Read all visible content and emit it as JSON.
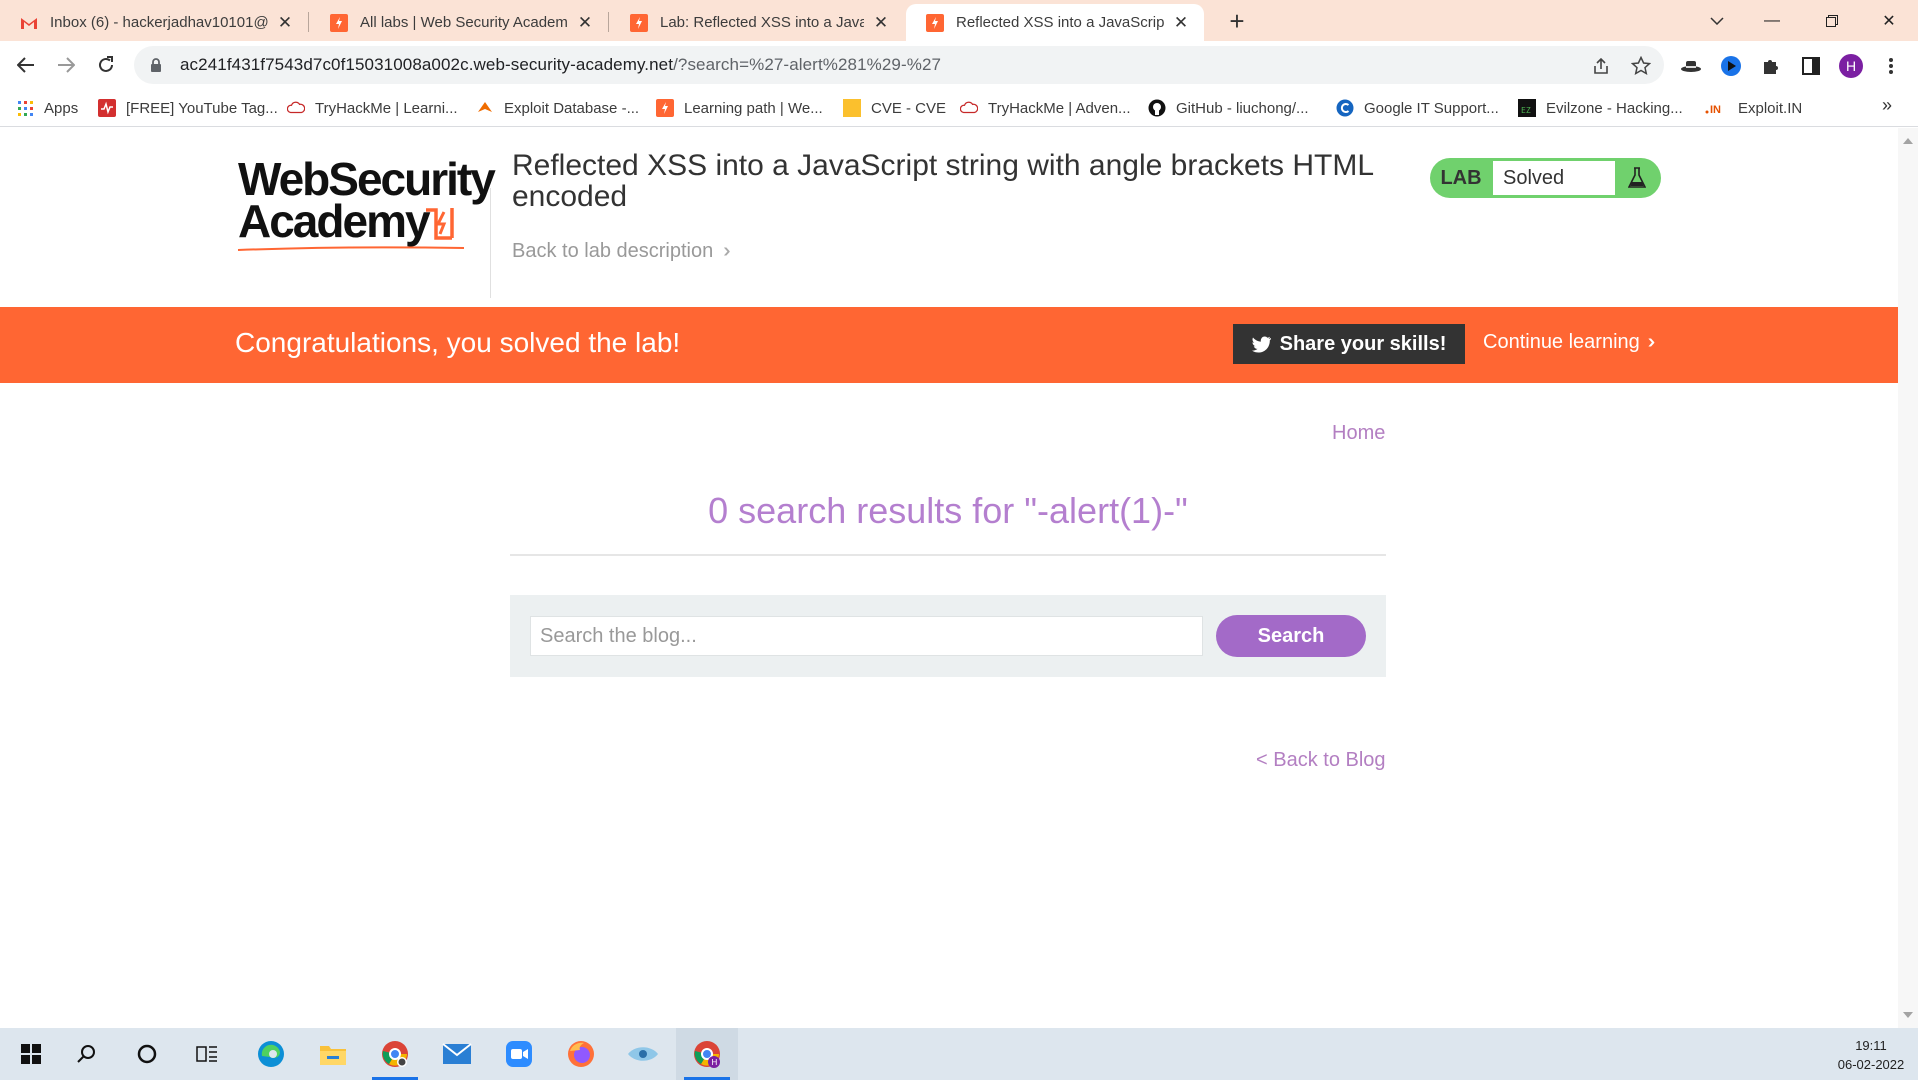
{
  "browser": {
    "tabs": [
      {
        "title": "Inbox (6) - hackerjadhav10101@",
        "icon": "gmail-icon",
        "active": false
      },
      {
        "title": "All labs | Web Security Academy",
        "icon": "portswigger-icon",
        "active": false
      },
      {
        "title": "Lab: Reflected XSS into a JavaScri",
        "icon": "portswigger-icon",
        "active": false
      },
      {
        "title": "Reflected XSS into a JavaScript st",
        "icon": "portswigger-icon",
        "active": true
      }
    ],
    "url_host": "ac241f431f7543d7c0f15031008a002c.web-security-academy.net",
    "url_path": "/?search=%27-alert%281%29-%27",
    "profile_initial": "H",
    "bookmarks": [
      {
        "label": "Apps",
        "icon": "apps-grid-icon"
      },
      {
        "label": "[FREE] YouTube Tag...",
        "icon": "tag-icon"
      },
      {
        "label": "TryHackMe | Learni...",
        "icon": "tryhackme-icon"
      },
      {
        "label": "Exploit Database -...",
        "icon": "exploitdb-icon"
      },
      {
        "label": "Learning path | We...",
        "icon": "portswigger-icon"
      },
      {
        "label": "CVE - CVE",
        "icon": "folder-icon"
      },
      {
        "label": "TryHackMe | Adven...",
        "icon": "tryhackme-icon"
      },
      {
        "label": "GitHub - liuchong/...",
        "icon": "github-icon"
      },
      {
        "label": "Google IT Support...",
        "icon": "coursera-icon"
      },
      {
        "label": "Evilzone - Hacking...",
        "icon": "evilzone-icon"
      },
      {
        "label": "Exploit.IN",
        "icon": "exploitin-icon"
      }
    ]
  },
  "page": {
    "logo_line1": "WebSecurity",
    "logo_line2": "Academy",
    "lab_title": "Reflected XSS into a JavaScript string with angle brackets HTML encoded",
    "back_to_description": "Back to lab description",
    "lab_badge_label": "LAB",
    "lab_status": "Solved",
    "banner_text": "Congratulations, you solved the lab!",
    "share_button": "Share your skills!",
    "continue_learning": "Continue learning",
    "home_link": "Home",
    "results_heading": "0 search results for \"-alert(1)-\"",
    "search_placeholder": "Search the blog...",
    "search_button": "Search",
    "back_to_blog": "< Back to Blog"
  },
  "taskbar": {
    "time": "19:11",
    "date": "06-02-2022"
  },
  "colors": {
    "accent_orange": "#ff6633",
    "purple_link": "#b37fc2",
    "search_button": "#a36ac8",
    "lab_badge_green": "#70d16d"
  }
}
